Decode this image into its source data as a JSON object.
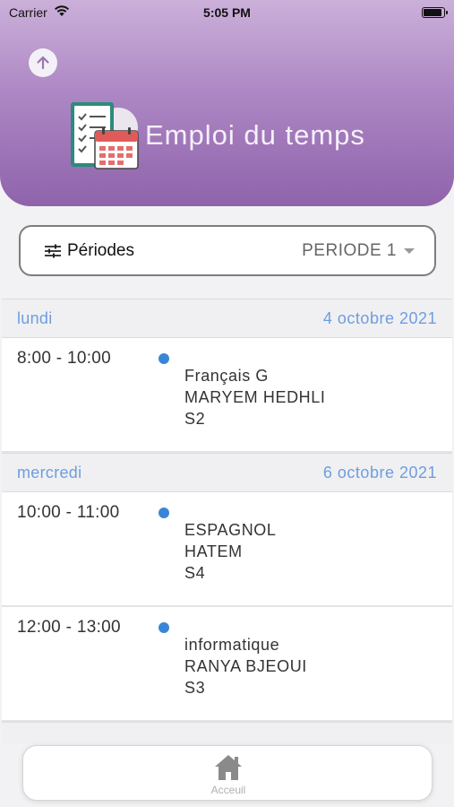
{
  "status_bar": {
    "carrier": "Carrier",
    "time": "5:05 PM"
  },
  "header": {
    "title": "Emploi du temps"
  },
  "period_selector": {
    "label": "Périodes",
    "value": "PERIODE 1"
  },
  "days": [
    {
      "name": "lundi",
      "date": "4 octobre 2021",
      "lessons": [
        {
          "time": "8:00 - 10:00",
          "subject": "Français G",
          "teacher": "MARYEM HEDHLI",
          "room": "S2"
        }
      ]
    },
    {
      "name": "mercredi",
      "date": "6 octobre 2021",
      "lessons": [
        {
          "time": "10:00 - 11:00",
          "subject": "ESPAGNOL",
          "teacher": "HATEM",
          "room": "S4"
        },
        {
          "time": "12:00 - 13:00",
          "subject": "informatique",
          "teacher": "RANYA BJEOUI",
          "room": "S3"
        }
      ]
    }
  ],
  "tab_bar": {
    "home_label": "Acceuil"
  },
  "colors": {
    "accent": "#3a86d6",
    "day_header_text": "#6d9de0",
    "header_gradient_top": "#cbb0d9",
    "header_gradient_bottom": "#8f63ab"
  }
}
